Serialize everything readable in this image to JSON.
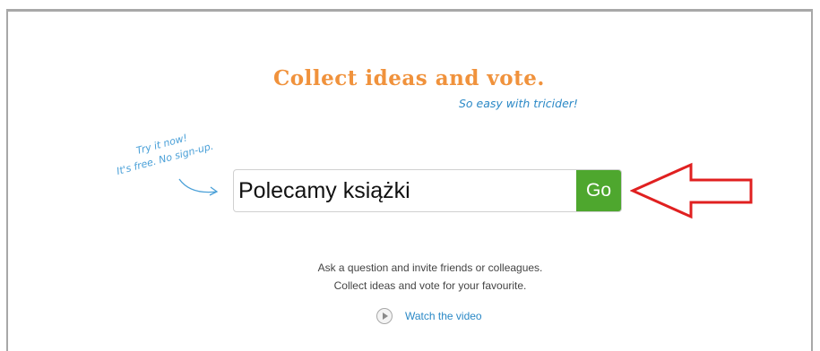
{
  "hero": {
    "headline": "Collect ideas and vote.",
    "tagline": "So easy with tricider!"
  },
  "hint": {
    "line1": "Try it now!",
    "line2": "It's free. No sign-up."
  },
  "search": {
    "value": "Polecamy książki",
    "button_label": "Go"
  },
  "description": {
    "line1": "Ask a question and invite friends or colleagues.",
    "line2": "Collect ideas and vote for your favourite."
  },
  "video": {
    "label": "Watch the video",
    "icon": "play-circle-icon"
  },
  "colors": {
    "headline": "#f0923c",
    "accent_blue": "#2a88c6",
    "go_green": "#4ea72e",
    "annotation_red": "#e02020"
  }
}
